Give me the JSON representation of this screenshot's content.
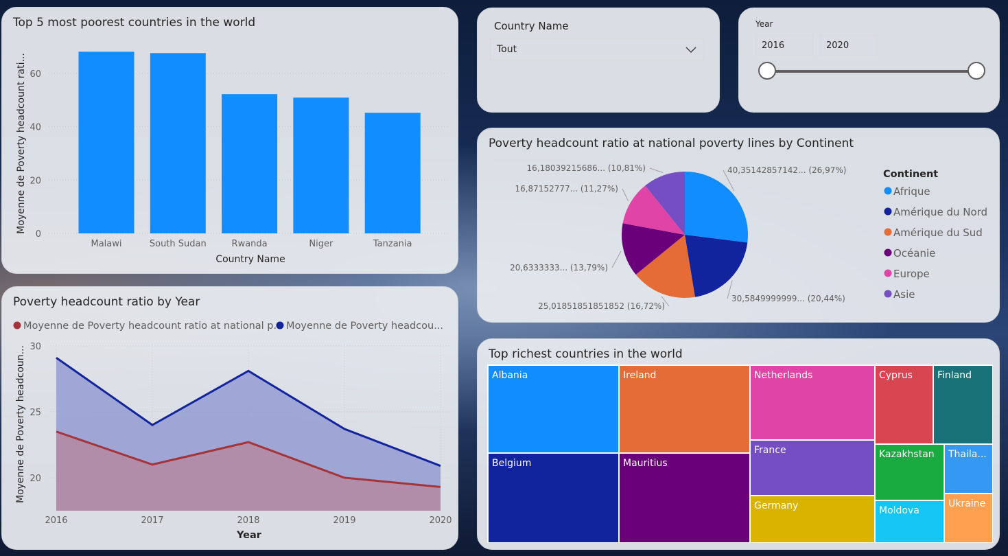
{
  "bar_panel": {
    "title": "Top 5 most poorest countries in the world"
  },
  "line_panel": {
    "title": "Poverty headcount ratio by Year"
  },
  "pie_panel": {
    "title": "Poverty headcount ratio at national poverty lines by Continent"
  },
  "tree_panel": {
    "title": "Top richest countries in the world"
  },
  "country_slicer": {
    "label": "Country Name",
    "value": "Tout"
  },
  "year_slicer": {
    "label": "Year",
    "start": "2016",
    "end": "2020",
    "range_fraction": [
      0,
      1
    ]
  },
  "colors": {
    "bar": "#118dff",
    "line_red": "#a4343a",
    "line_blue": "#12239e"
  },
  "chart_data": [
    {
      "type": "bar",
      "categories": [
        "Malawi",
        "South Sudan",
        "Rwanda",
        "Niger",
        "Tanzania"
      ],
      "values": [
        68.1,
        67.6,
        52.2,
        50.9,
        45.2
      ],
      "ylabel": "Moyenne de Poverty headcount rati...",
      "xlabel": "Country Name",
      "yticks": [
        "0",
        "20",
        "40",
        "60"
      ],
      "ylim": [
        0,
        70
      ],
      "grid": true
    },
    {
      "type": "area",
      "x": [
        "2016",
        "2017",
        "2018",
        "2019",
        "2020"
      ],
      "series": [
        {
          "name": "Moyenne de Poverty headcount ratio at national p...",
          "color": "#a4343a",
          "values": [
            23.5,
            21.0,
            22.7,
            20.0,
            19.3
          ]
        },
        {
          "name": "Moyenne de Poverty headcou...",
          "color": "#12239e",
          "values": [
            29.1,
            24.0,
            28.1,
            23.7,
            20.9
          ]
        }
      ],
      "ylabel": "Moyenne de Poverty headcoun...",
      "xlabel": "Year",
      "yticks": [
        "20",
        "25",
        "30"
      ],
      "ylim": [
        17.5,
        30
      ],
      "grid": true
    },
    {
      "type": "pie",
      "legend_title": "Continent",
      "slices": [
        {
          "name": "Afrique",
          "color": "#118dff",
          "label": "40,35142857142... (26,97%)",
          "percent": 26.97
        },
        {
          "name": "Amérique du Nord",
          "color": "#12239e",
          "label": "30,5849999999... (20,44%)",
          "percent": 20.44
        },
        {
          "name": "Amérique du Sud",
          "color": "#e66c37",
          "label": "25,01851851851852 (16,72%)",
          "percent": 16.72
        },
        {
          "name": "Océanie",
          "color": "#6b007b",
          "label": "20,6333333... (13,79%)",
          "percent": 13.79
        },
        {
          "name": "Europe",
          "color": "#e044a7",
          "label": "16,87152777... (11,27%)",
          "percent": 11.27
        },
        {
          "name": "Asie",
          "color": "#744ec2",
          "label": "16,18039215686... (10,81%)",
          "percent": 10.81
        }
      ],
      "legend_placement": "right"
    },
    {
      "type": "treemap",
      "cells": [
        {
          "name": "Albania",
          "color": "#118dff"
        },
        {
          "name": "Belgium",
          "color": "#12239e"
        },
        {
          "name": "Ireland",
          "color": "#e66c37"
        },
        {
          "name": "Mauritius",
          "color": "#6b007b"
        },
        {
          "name": "Netherlands",
          "color": "#e044a7"
        },
        {
          "name": "France",
          "color": "#744ec2"
        },
        {
          "name": "Germany",
          "color": "#d9b300"
        },
        {
          "name": "Cyprus",
          "color": "#d64550"
        },
        {
          "name": "Finland",
          "color": "#197278"
        },
        {
          "name": "Kazakhstan",
          "color": "#1aab40"
        },
        {
          "name": "Thaila...",
          "color": "#3599f4"
        },
        {
          "name": "Moldova",
          "color": "#15c6f4"
        },
        {
          "name": "Ukraine",
          "color": "#ff9f50"
        }
      ]
    }
  ]
}
